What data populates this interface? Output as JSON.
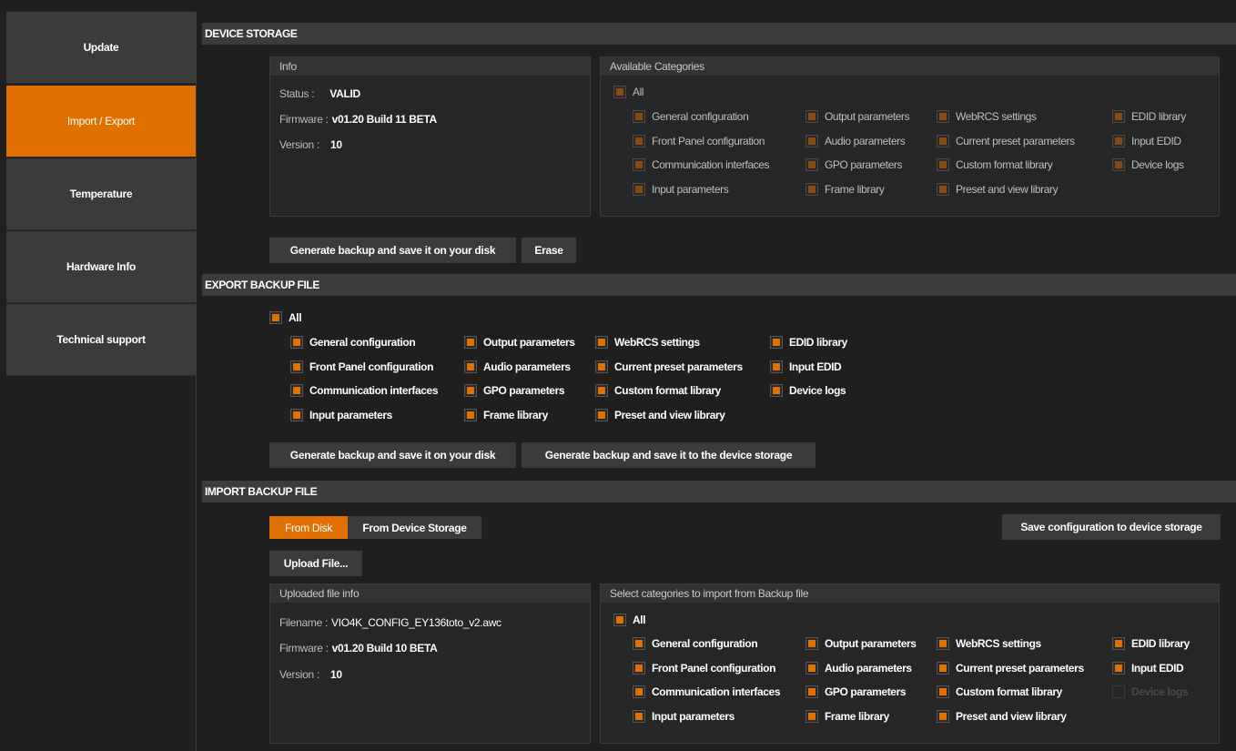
{
  "sidebar": {
    "items": [
      {
        "label": "Update"
      },
      {
        "label": "Import / Export"
      },
      {
        "label": "Temperature"
      },
      {
        "label": "Hardware Info"
      },
      {
        "label": "Technical support"
      }
    ],
    "active_index": 1
  },
  "device_storage": {
    "header": "DEVICE STORAGE",
    "info": {
      "title": "Info",
      "status_key": "Status :",
      "status_val": "VALID",
      "firmware_key": "Firmware :",
      "firmware_val": "v01.20 Build 11 BETA",
      "version_key": "Version :",
      "version_val": "10"
    },
    "categories": {
      "title": "Available Categories",
      "all": "All",
      "items": [
        "General configuration",
        "Output parameters",
        "WebRCS settings",
        "EDID library",
        "Front Panel configuration",
        "Audio parameters",
        "Current preset parameters",
        "Input EDID",
        "Communication interfaces",
        "GPO parameters",
        "Custom format library",
        "Device logs",
        "Input parameters",
        "Frame library",
        "Preset and view library"
      ]
    },
    "generate_label": "Generate backup and save it on your disk",
    "erase_label": "Erase"
  },
  "export": {
    "header": "EXPORT BACKUP FILE",
    "all": "All",
    "items": [
      "General configuration",
      "Output parameters",
      "WebRCS settings",
      "EDID library",
      "Front Panel configuration",
      "Audio parameters",
      "Current preset parameters",
      "Input EDID",
      "Communication interfaces",
      "GPO parameters",
      "Custom format library",
      "Device logs",
      "Input parameters",
      "Frame library",
      "Preset and view library"
    ],
    "generate_disk_label": "Generate backup and save it on your disk",
    "generate_storage_label": "Generate backup and save it to the device storage"
  },
  "import": {
    "header": "IMPORT BACKUP FILE",
    "tab_disk": "From Disk",
    "tab_storage": "From Device Storage",
    "save_config_label": "Save configuration to device storage",
    "upload_label": "Upload File...",
    "file_info": {
      "title": "Uploaded file info",
      "filename_key": "Filename :",
      "filename_val": "VIO4K_CONFIG_EY136toto_v2.awc",
      "firmware_key": "Firmware :",
      "firmware_val": "v01.20 Build 10 BETA",
      "version_key": "Version :",
      "version_val": "10"
    },
    "categories": {
      "title": "Select categories to import from Backup file",
      "all": "All",
      "items": [
        "General configuration",
        "Output parameters",
        "WebRCS settings",
        "EDID library",
        "Front Panel configuration",
        "Audio parameters",
        "Current preset parameters",
        "Input EDID",
        "Communication interfaces",
        "GPO parameters",
        "Custom format library",
        "Device logs",
        "Input parameters",
        "Frame library",
        "Preset and view library"
      ]
    }
  },
  "colors": {
    "accent": "#e07000",
    "panel": "#262626",
    "header": "#3c3c3c"
  }
}
